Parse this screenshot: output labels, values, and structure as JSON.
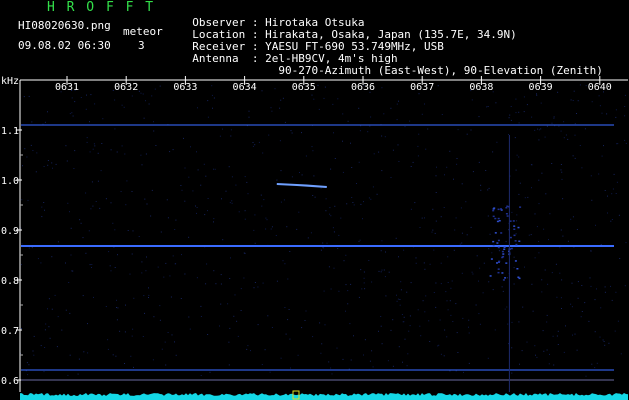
{
  "header": {
    "app_title": "H R O F F T",
    "file_name": "HI08020630.png",
    "date_time": "09.08.02 06:30",
    "meteor_label": "meteor",
    "meteor_count": "3"
  },
  "info": [
    {
      "label": "Observer",
      "value": "Hirotaka Otsuka"
    },
    {
      "label": "Location",
      "value": "Hirakata, Osaka, Japan (135.7E, 34.9N)"
    },
    {
      "label": "Receiver",
      "value": "YAESU FT-690 53.749MHz, USB"
    },
    {
      "label": "Antenna ",
      "value": "2el-HB9CV, 4m's high"
    },
    {
      "label": "        ",
      "value": "  90-270-Azimuth (East-West), 90-Elevation (Zenith)"
    }
  ],
  "colors": {
    "background": "#000000",
    "title_green": "#33e04a",
    "axis_line": "#ffffff",
    "carrier": "#3a6bff",
    "noise_cyan": "#14d8e6"
  },
  "chart_data": {
    "type": "heatmap",
    "title": "",
    "xlabel": "",
    "ylabel": "kHz",
    "x_ticks": [
      "0631",
      "0632",
      "0633",
      "0634",
      "0635",
      "0636",
      "0637",
      "0638",
      "0639",
      "0640"
    ],
    "y_ticks": [
      "1.1",
      "1.0",
      "0.9",
      "0.8",
      "0.7",
      "0.6"
    ],
    "ylim": [
      0.6,
      1.1
    ],
    "carrier_lines_khz": [
      1.11,
      0.868,
      0.62
    ],
    "meteor_echoes": [
      {
        "time": "0635",
        "freq_khz": 0.99
      }
    ],
    "grid": false
  }
}
